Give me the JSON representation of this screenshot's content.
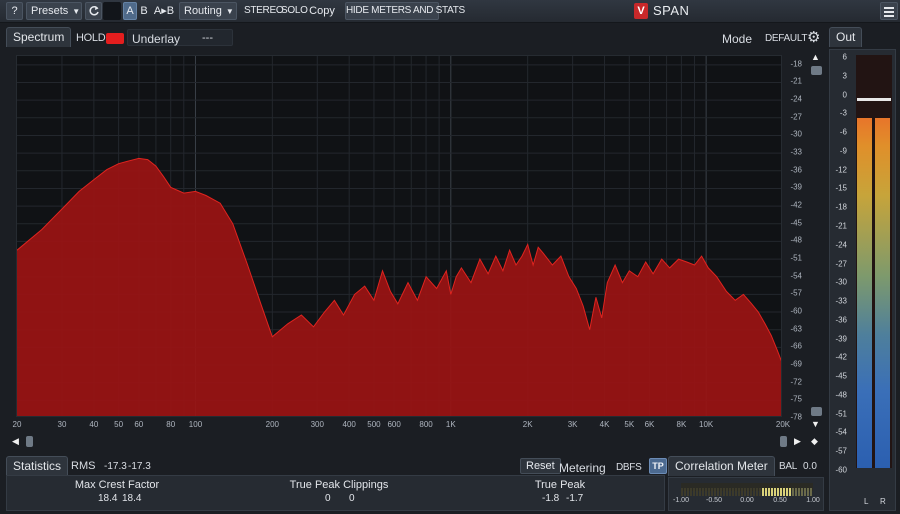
{
  "toolbar": {
    "help_label": "?",
    "presets_label": "Presets",
    "a_label": "A",
    "b_label": "B",
    "ab_label": "A▸B",
    "routing_label": "Routing",
    "stereo_label": "STEREO",
    "solo_label": "SOLO",
    "copy_label": "Copy",
    "hide_label": "HIDE METERS AND STATS"
  },
  "app": {
    "logo_letter": "V",
    "title": "SPAN"
  },
  "spectrum": {
    "tab_label": "Spectrum",
    "hold_label": "HOLD",
    "underlay_label": "Underlay",
    "underlay_value": "---",
    "mode_label": "Mode",
    "mode_value": "DEFAULT",
    "fill_color": "#9b1413",
    "line_color": "#e0241f"
  },
  "chart_data": {
    "type": "area",
    "x_scale": "log",
    "xlim": [
      20,
      20000
    ],
    "ylim": [
      -78,
      -16.5
    ],
    "x_ticks": [
      20,
      30,
      40,
      50,
      60,
      80,
      100,
      200,
      300,
      400,
      500,
      600,
      800,
      1000,
      2000,
      3000,
      4000,
      5000,
      6000,
      8000,
      10000,
      20000
    ],
    "x_tick_labels": [
      "20",
      "30",
      "40",
      "50",
      "60",
      "80",
      "100",
      "200",
      "300",
      "400",
      "500",
      "600",
      "800",
      "1K",
      "2K",
      "3K",
      "4K",
      "5K",
      "6K",
      "8K",
      "10K",
      "20K"
    ],
    "y_ticks": [
      -18,
      -21,
      -24,
      -27,
      -30,
      -33,
      -36,
      -39,
      -42,
      -45,
      -48,
      -51,
      -54,
      -57,
      -60,
      -63,
      -66,
      -69,
      -72,
      -75,
      -78
    ],
    "series": [
      {
        "x": [
          20,
          25,
          30,
          35,
          40,
          45,
          50,
          55,
          60,
          65,
          70,
          75,
          80,
          90,
          100,
          110,
          125,
          140,
          160,
          180,
          200,
          230,
          260,
          290,
          320,
          350,
          380,
          420,
          460,
          500,
          540,
          580,
          620,
          680,
          740,
          800,
          880,
          960,
          1000,
          1050,
          1100,
          1200,
          1300,
          1400,
          1500,
          1600,
          1700,
          1800,
          1900,
          2000,
          2100,
          2200,
          2300,
          2500,
          2700,
          2900,
          3100,
          3300,
          3500,
          3700,
          3900,
          4100,
          4400,
          4700,
          5000,
          5400,
          5800,
          6200,
          6700,
          7200,
          7800,
          8400,
          9000,
          9600,
          10200,
          11000,
          12000,
          13000,
          14000,
          15000,
          16000,
          17000,
          18000,
          19000,
          20000
        ],
        "y": [
          -49.5,
          -46,
          -42.5,
          -39.5,
          -37.5,
          -35.8,
          -34.8,
          -34.3,
          -33.9,
          -34.1,
          -35.2,
          -37,
          -38.8,
          -39.8,
          -39.5,
          -40.2,
          -41.5,
          -45,
          -52,
          -58.5,
          -64.2,
          -62,
          -60.5,
          -62.5,
          -60,
          -58,
          -60.5,
          -57,
          -55.6,
          -58,
          -53,
          -56.5,
          -58.6,
          -55,
          -58,
          -54,
          -56,
          -53,
          -57,
          -54,
          -52.5,
          -55,
          -51,
          -53.5,
          -50.5,
          -53,
          -49.5,
          -52,
          -50.5,
          -48.5,
          -52,
          -49,
          -50,
          -52,
          -50.5,
          -54,
          -56,
          -59,
          -63,
          -57.5,
          -61,
          -55,
          -52,
          -55,
          -53,
          -54,
          -51.5,
          -53.5,
          -51,
          -52.5,
          -51,
          -51.5,
          -52,
          -50.5,
          -52.5,
          -54,
          -56.5,
          -58,
          -57,
          -58.5,
          -60,
          -62,
          -64,
          -66.5,
          -69
        ]
      }
    ]
  },
  "statistics": {
    "tab_label": "Statistics",
    "rms_label": "RMS",
    "rms_l": "-17.3",
    "rms_r": "-17.3",
    "reset_label": "Reset",
    "metering_label": "Metering",
    "metering_value": "DBFS",
    "tp_label": "TP",
    "crest_label": "Max Crest Factor",
    "crest_l": "18.4",
    "crest_r": "18.4",
    "clip_label": "True Peak Clippings",
    "clip_l": "0",
    "clip_r": "0",
    "peak_label": "True Peak",
    "peak_l": "-1.8",
    "peak_r": "-1.7"
  },
  "correlation": {
    "tab_label": "Correlation Meter",
    "bal_label": "BAL",
    "bal_value": "0.0",
    "ticks": [
      "-1.00",
      "-0.50",
      "0.00",
      "0.50",
      "1.00"
    ]
  },
  "out_meter": {
    "tab_label": "Out",
    "scale": [
      "6",
      "3",
      "0",
      "-3",
      "-6",
      "-9",
      "-12",
      "-15",
      "-18",
      "-21",
      "-24",
      "-27",
      "-30",
      "-33",
      "-36",
      "-39",
      "-42",
      "-45",
      "-48",
      "-51",
      "-54",
      "-57",
      "-60"
    ],
    "left_label": "L",
    "right_label": "R",
    "left_level_db": -4,
    "right_level_db": -4,
    "peak_hold_db": 0
  }
}
